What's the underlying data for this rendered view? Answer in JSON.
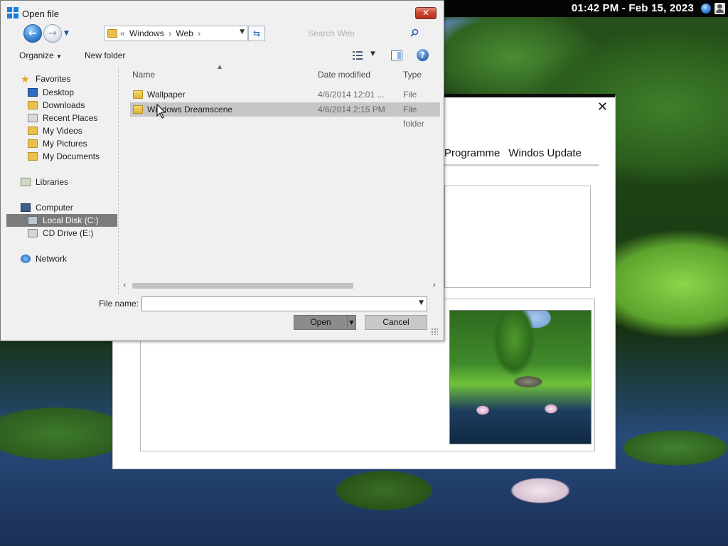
{
  "top_bar": {
    "clock": "01:42 PM - Feb 15, 2023"
  },
  "background_window": {
    "close_glyph": "✕",
    "tabs": [
      "Programme",
      "Windos Update"
    ]
  },
  "dialog": {
    "title": "Open file",
    "close_glyph": "✕",
    "address": {
      "crumbs": [
        "«",
        "Windows",
        "›",
        "Web",
        "›"
      ]
    },
    "search": {
      "placeholder": "Search Web"
    },
    "toolbar": {
      "organize": "Organize",
      "new_folder": "New folder",
      "help_glyph": "?"
    },
    "nav_pane": {
      "favorites": "Favorites",
      "desktop": "Desktop",
      "downloads": "Downloads",
      "recent_places": "Recent Places",
      "my_videos": "My Videos",
      "my_pictures": "My Pictures",
      "my_documents": "My Documents",
      "libraries": "Libraries",
      "computer": "Computer",
      "local_disk": "Local Disk (C:)",
      "cd_drive": "CD Drive (E:)",
      "network": "Network"
    },
    "columns": {
      "name": "Name",
      "date_modified": "Date modified",
      "type": "Type"
    },
    "files": [
      {
        "name": "Wallpaper",
        "date": "4/6/2014 12:01 ...",
        "type": "File folder"
      },
      {
        "name": "Windows Dreamscene",
        "date": "4/6/2014 2:15 PM",
        "type": "File folder"
      }
    ],
    "file_name_label": "File name:",
    "file_name_value": "",
    "open_button": "Open",
    "cancel_button": "Cancel"
  },
  "colors": {
    "selection": "#7b7b7b",
    "row_selection": "#c6c6c6",
    "accent": "#1a7de0"
  },
  "icons": [
    "windows-logo-icon",
    "close-icon",
    "back-arrow-icon",
    "forward-arrow-icon",
    "folder-icon",
    "refresh-icon",
    "search-icon",
    "views-icon",
    "preview-pane-icon",
    "help-icon",
    "star-icon",
    "desktop-icon",
    "computer-icon",
    "disk-icon",
    "cd-drive-icon",
    "network-icon",
    "globe-icon",
    "user-icon"
  ]
}
